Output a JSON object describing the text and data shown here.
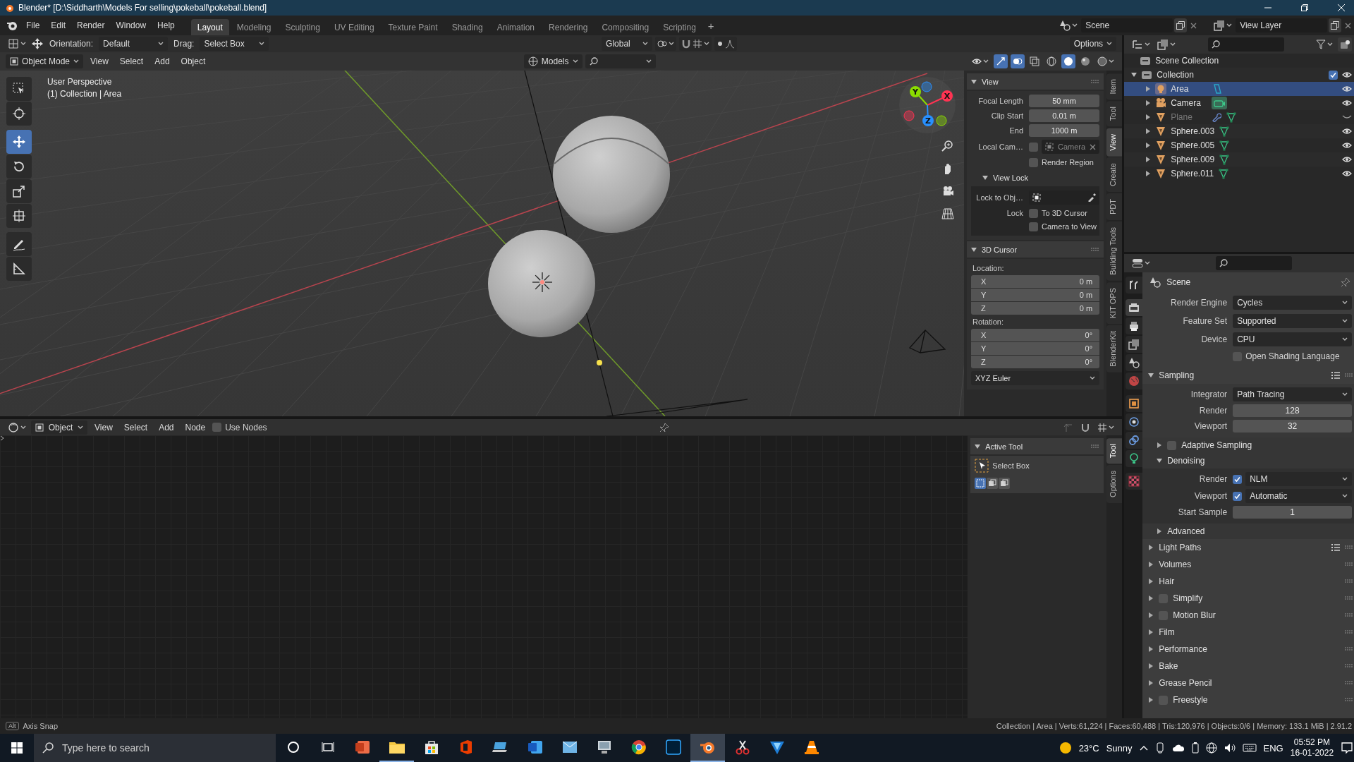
{
  "window": {
    "title": "Blender* [D:\\Siddharth\\Models For selling\\pokeball\\pokeball.blend]"
  },
  "menu": [
    "File",
    "Edit",
    "Render",
    "Window",
    "Help"
  ],
  "workspaces": [
    {
      "label": "Layout",
      "selected": true
    },
    {
      "label": "Modeling",
      "selected": false
    },
    {
      "label": "Sculpting",
      "selected": false
    },
    {
      "label": "UV Editing",
      "selected": false
    },
    {
      "label": "Texture Paint",
      "selected": false
    },
    {
      "label": "Shading",
      "selected": false
    },
    {
      "label": "Animation",
      "selected": false
    },
    {
      "label": "Rendering",
      "selected": false
    },
    {
      "label": "Compositing",
      "selected": false
    },
    {
      "label": "Scripting",
      "selected": false
    }
  ],
  "add_workspace": "+",
  "scene": "Scene",
  "view_layer": "View Layer",
  "tool_header": {
    "orientation_label": "Orientation:",
    "orientation": "Default",
    "drag_label": "Drag:",
    "drag": "Select Box",
    "transform": "Global",
    "options": "Options"
  },
  "viewport_header": {
    "mode": "Object Mode",
    "menus": [
      "View",
      "Select",
      "Add",
      "Object"
    ],
    "filter": "Models"
  },
  "viewport": {
    "perspective": "User Perspective",
    "context": "(1) Collection | Area",
    "tools": [
      {
        "kind": "select",
        "selected": false
      },
      {
        "kind": "cursor",
        "selected": false
      },
      {
        "kind": "move",
        "selected": true
      },
      {
        "kind": "rotate",
        "selected": false
      },
      {
        "kind": "scale",
        "selected": false
      },
      {
        "kind": "transform",
        "selected": false
      },
      {
        "kind": "annotate",
        "selected": false
      },
      {
        "kind": "measure",
        "selected": false
      }
    ],
    "gizmo": [
      {
        "label": "Y",
        "color": "#8bdc00"
      },
      {
        "label": "X",
        "color": "#ff3352"
      },
      {
        "label": "Z",
        "color": "#2890ff"
      }
    ]
  },
  "sidebar": {
    "tabs": [
      {
        "label": "Item",
        "selected": false
      },
      {
        "label": "Tool",
        "selected": false
      },
      {
        "label": "View",
        "selected": true
      },
      {
        "label": "Create",
        "selected": false
      },
      {
        "label": "PDT",
        "selected": false
      },
      {
        "label": "Building Tools",
        "selected": false
      },
      {
        "label": "KIT OPS",
        "selected": false
      },
      {
        "label": "BlenderKit",
        "selected": false
      }
    ],
    "view_panel": {
      "title": "View",
      "expanded": true,
      "rows": [
        {
          "kind": "number",
          "label": "Focal Length",
          "value": "50 mm"
        },
        {
          "kind": "number",
          "label": "Clip Start",
          "value": "0.01 m"
        },
        {
          "kind": "number",
          "label": "End",
          "value": "1000 m"
        },
        {
          "kind": "camera",
          "label": "Local Cam…",
          "checked": false,
          "value": "Camera"
        },
        {
          "kind": "check",
          "text": "Render Region",
          "checked": false
        }
      ]
    },
    "view_lock": {
      "title": "View Lock",
      "expanded": true,
      "rows": [
        {
          "kind": "picker",
          "label": "Lock to Obj…"
        },
        {
          "kind": "check",
          "label": "Lock",
          "text": "To 3D Cursor",
          "checked": false
        },
        {
          "kind": "check",
          "text": "Camera to View",
          "checked": false
        }
      ]
    },
    "cursor_panel": {
      "title": "3D Cursor",
      "expanded": true,
      "location_label": "Location:",
      "location": [
        {
          "axis": "X",
          "value": "0 m"
        },
        {
          "axis": "Y",
          "value": "0 m"
        },
        {
          "axis": "Z",
          "value": "0 m"
        }
      ],
      "rotation_label": "Rotation:",
      "rotation": [
        {
          "axis": "X",
          "value": "0°"
        },
        {
          "axis": "Y",
          "value": "0°"
        },
        {
          "axis": "Z",
          "value": "0°"
        }
      ],
      "mode": "XYZ Euler"
    }
  },
  "node_editor": {
    "slot": "Object",
    "menus": [
      "View",
      "Select",
      "Add",
      "Node"
    ],
    "use_nodes": {
      "label": "Use Nodes",
      "checked": false
    },
    "active_tool": {
      "title": "Active Tool",
      "expanded": true,
      "tool": "Select Box",
      "modes": [
        {
          "selected": true
        },
        {
          "selected": false
        },
        {
          "selected": false
        }
      ]
    },
    "tabs": [
      {
        "label": "Tool",
        "selected": true
      },
      {
        "label": "Options",
        "selected": false
      }
    ]
  },
  "outliner": {
    "root": "Scene Collection",
    "items": [
      {
        "label": "Collection",
        "kind": "collection",
        "expanded": true,
        "checked": true,
        "visible": true,
        "children": [
          {
            "label": "Area",
            "kind": "light",
            "expanded": false,
            "selected": true,
            "visible": true
          },
          {
            "label": "Camera",
            "kind": "camera",
            "expanded": false,
            "selected": false,
            "visible": true
          },
          {
            "label": "Plane",
            "kind": "mesh",
            "expanded": false,
            "selected": false,
            "visible": false,
            "modifier": true
          },
          {
            "label": "Sphere.003",
            "kind": "mesh",
            "expanded": false,
            "selected": false,
            "visible": true
          },
          {
            "label": "Sphere.005",
            "kind": "mesh",
            "expanded": false,
            "selected": false,
            "visible": true
          },
          {
            "label": "Sphere.009",
            "kind": "mesh",
            "expanded": false,
            "selected": false,
            "visible": true
          },
          {
            "label": "Sphere.011",
            "kind": "mesh",
            "expanded": false,
            "selected": false,
            "visible": true
          }
        ]
      }
    ]
  },
  "properties": {
    "tabs": [
      {
        "kind": "tool",
        "selected": false
      },
      {
        "kind": "render",
        "selected": true
      },
      {
        "kind": "output",
        "selected": false
      },
      {
        "kind": "view_layer",
        "selected": false
      },
      {
        "kind": "scene",
        "selected": false
      },
      {
        "kind": "world",
        "selected": false
      },
      {
        "kind": "object",
        "selected": false
      },
      {
        "kind": "physics",
        "selected": false
      },
      {
        "kind": "constraints",
        "selected": false
      },
      {
        "kind": "data",
        "selected": false
      },
      {
        "kind": "texture",
        "selected": false
      }
    ],
    "context": "Scene",
    "settings": [
      {
        "kind": "dropdown",
        "label": "Render Engine",
        "value": "Cycles"
      },
      {
        "kind": "dropdown",
        "label": "Feature Set",
        "value": "Supported"
      },
      {
        "kind": "dropdown",
        "label": "Device",
        "value": "CPU"
      },
      {
        "kind": "check",
        "text": "Open Shading Language",
        "checked": false
      }
    ],
    "panels": [
      {
        "title": "Sampling",
        "expanded": true,
        "presets": true,
        "rows": [
          {
            "kind": "dropdown",
            "label": "Integrator",
            "value": "Path Tracing"
          },
          {
            "kind": "number",
            "label": "Render",
            "value": "128"
          },
          {
            "kind": "number",
            "label": "Viewport",
            "value": "32"
          }
        ],
        "subpanels": [
          {
            "title": "Adaptive Sampling",
            "expanded": false,
            "checked": false
          },
          {
            "title": "Denoising",
            "expanded": true,
            "rows": [
              {
                "kind": "check_dropdown",
                "label": "Render",
                "checked": true,
                "value": "NLM"
              },
              {
                "kind": "check_dropdown",
                "label": "Viewport",
                "checked": true,
                "value": "Automatic"
              },
              {
                "kind": "number",
                "label": "Start Sample",
                "value": "1"
              }
            ]
          },
          {
            "title": "Advanced",
            "expanded": false
          }
        ]
      },
      {
        "title": "Light Paths",
        "expanded": false,
        "presets": true
      },
      {
        "title": "Volumes",
        "expanded": false
      },
      {
        "title": "Hair",
        "expanded": false
      },
      {
        "title": "Simplify",
        "expanded": false,
        "checked": false
      },
      {
        "title": "Motion Blur",
        "expanded": false,
        "checked": false
      },
      {
        "title": "Film",
        "expanded": false
      },
      {
        "title": "Performance",
        "expanded": false
      },
      {
        "title": "Bake",
        "expanded": false
      },
      {
        "title": "Grease Pencil",
        "expanded": false
      },
      {
        "title": "Freestyle",
        "expanded": false,
        "checked": false
      }
    ]
  },
  "status_bar": {
    "key": "Alt",
    "hint": "Axis Snap",
    "stats": "Collection | Area | Verts:61,224 | Faces:60,488 | Tris:120,976 | Objects:0/6 | Memory: 133.1 MiB | 2.91.2"
  },
  "taskbar": {
    "search_placeholder": "Type here to search",
    "apps": [
      {
        "kind": "slides",
        "running": false,
        "active": false
      },
      {
        "kind": "folder",
        "running": true,
        "active": false
      },
      {
        "kind": "store",
        "running": false,
        "active": false
      },
      {
        "kind": "office",
        "running": false,
        "active": false
      },
      {
        "kind": "laptop",
        "running": false,
        "active": false
      },
      {
        "kind": "document",
        "running": false,
        "active": false
      },
      {
        "kind": "mail",
        "running": false,
        "active": false
      },
      {
        "kind": "computer",
        "running": false,
        "active": false
      },
      {
        "kind": "browser",
        "running": false,
        "active": false
      },
      {
        "kind": "photo",
        "running": false,
        "active": false
      },
      {
        "kind": "modeler",
        "running": true,
        "active": true
      },
      {
        "kind": "scissors",
        "running": false,
        "active": false
      },
      {
        "kind": "vector",
        "running": false,
        "active": false
      },
      {
        "kind": "cone",
        "running": false,
        "active": false
      }
    ],
    "temperature": "23°C",
    "weather": "Sunny",
    "language": "ENG",
    "time": "05:52 PM",
    "date": "16-01-2022"
  }
}
